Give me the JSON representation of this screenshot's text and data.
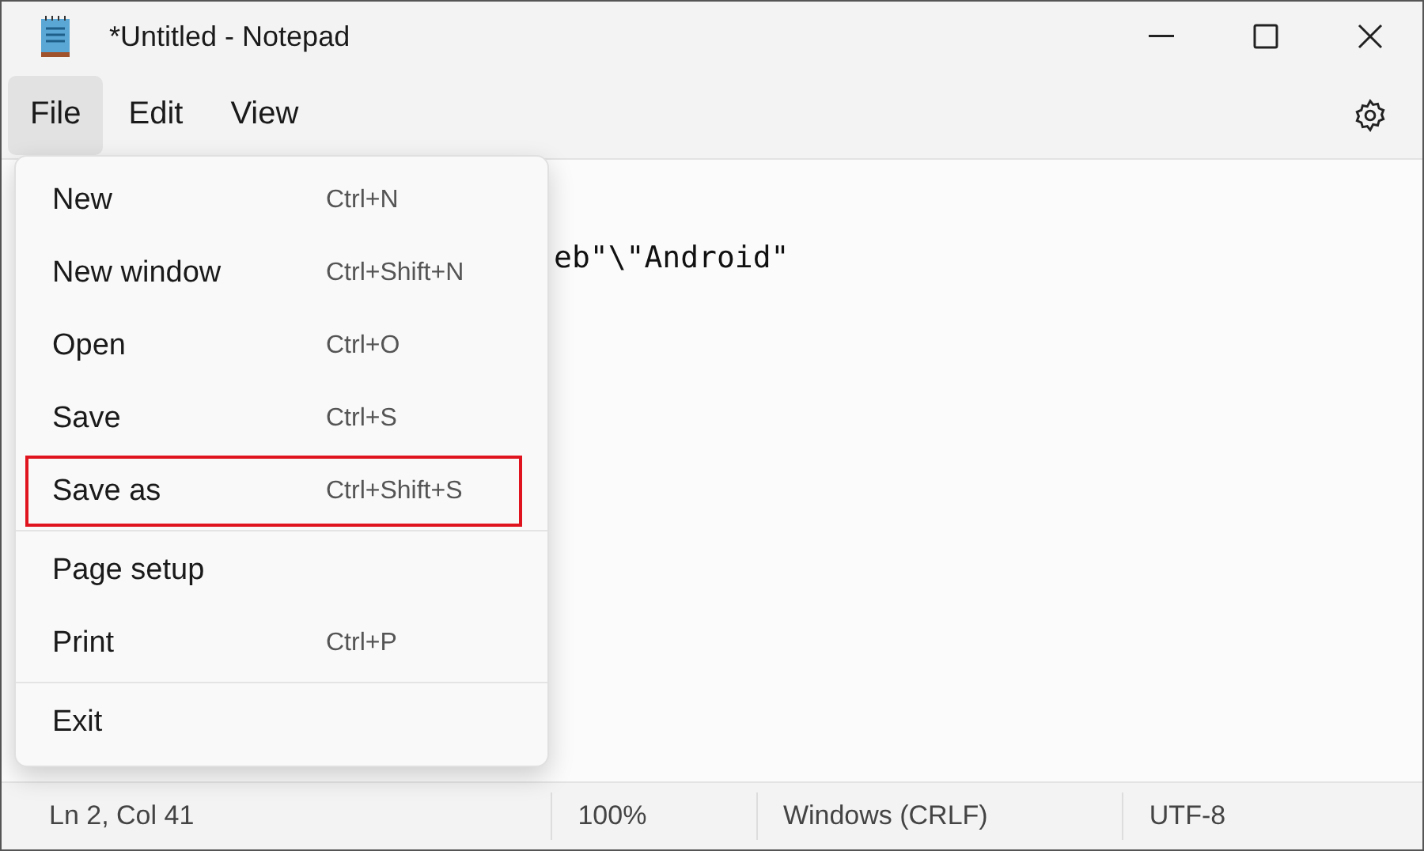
{
  "window": {
    "title": "*Untitled - Notepad"
  },
  "menu_bar": [
    {
      "label": "File",
      "selected": true
    },
    {
      "label": "Edit",
      "selected": false
    },
    {
      "label": "View",
      "selected": false
    }
  ],
  "editor": {
    "lines": [
      "eb\"\\\"Android\""
    ]
  },
  "file_menu": {
    "groups": [
      [
        {
          "label": "New",
          "shortcut": "Ctrl+N",
          "highlighted": false
        },
        {
          "label": "New window",
          "shortcut": "Ctrl+Shift+N",
          "highlighted": false
        },
        {
          "label": "Open",
          "shortcut": "Ctrl+O",
          "highlighted": false
        },
        {
          "label": "Save",
          "shortcut": "Ctrl+S",
          "highlighted": false
        },
        {
          "label": "Save as",
          "shortcut": "Ctrl+Shift+S",
          "highlighted": true
        }
      ],
      [
        {
          "label": "Page setup",
          "highlighted": false
        },
        {
          "label": "Print",
          "shortcut": "Ctrl+P",
          "highlighted": false
        }
      ],
      [
        {
          "label": "Exit",
          "highlighted": false
        }
      ]
    ]
  },
  "status_bar": [
    "Ln 2, Col 41",
    "100%",
    "Windows (CRLF)",
    "UTF-8"
  ]
}
